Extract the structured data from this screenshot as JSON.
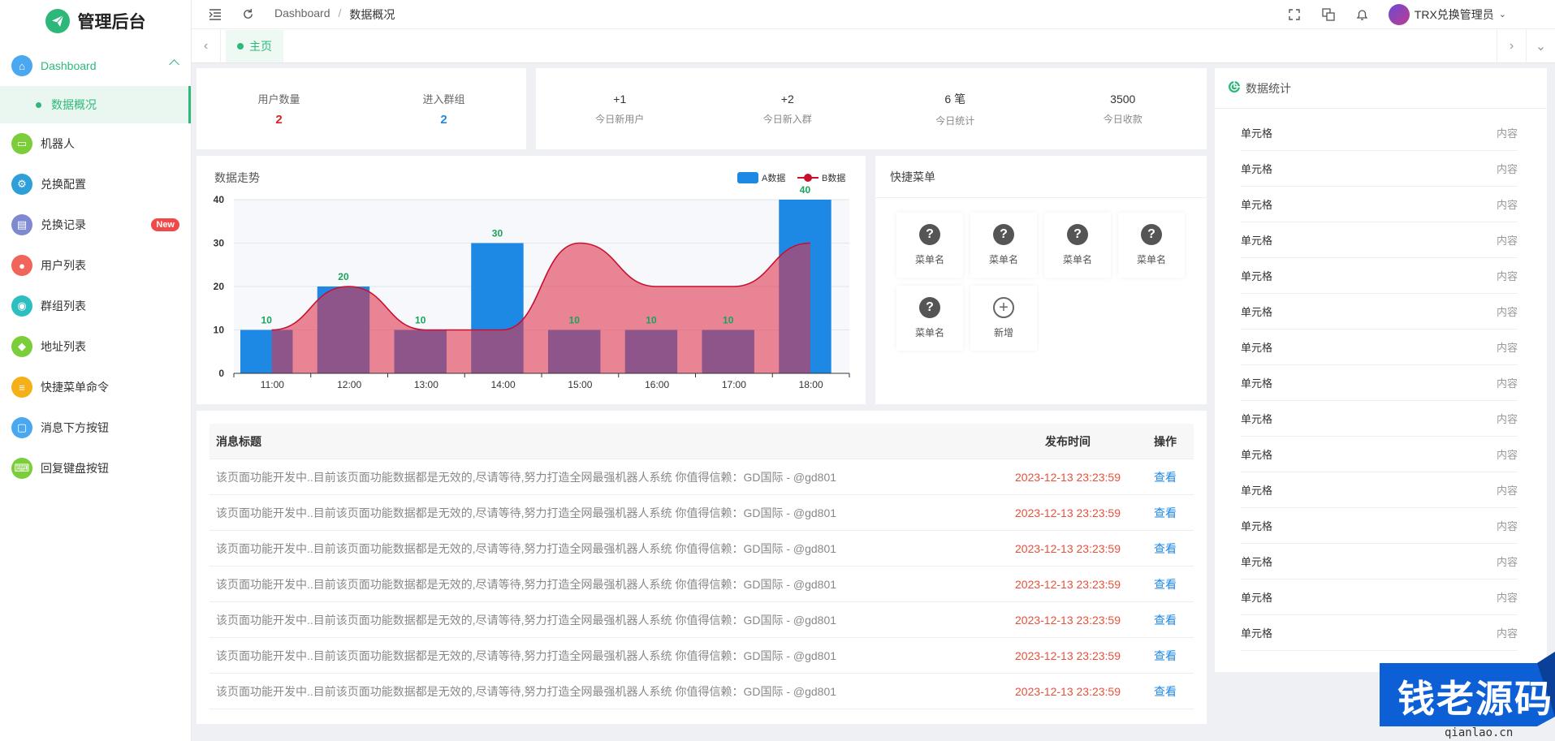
{
  "app": {
    "title": "管理后台"
  },
  "sidebar": {
    "items": [
      {
        "label": "Dashboard",
        "color": "#4aa8f0",
        "icon": "home-icon"
      },
      {
        "label": "机器人",
        "color": "#7ccd3a",
        "icon": "monitor-icon"
      },
      {
        "label": "兑换配置",
        "color": "#2e9fd8",
        "icon": "gear-icon"
      },
      {
        "label": "兑换记录",
        "color": "#7d8ad0",
        "icon": "document-icon",
        "badge": "New"
      },
      {
        "label": "用户列表",
        "color": "#f0645a",
        "icon": "user-icon"
      },
      {
        "label": "群组列表",
        "color": "#2dbfbf",
        "icon": "group-icon"
      },
      {
        "label": "地址列表",
        "color": "#7ccd3a",
        "icon": "cube-icon"
      },
      {
        "label": "快捷菜单命令",
        "color": "#f5b019",
        "icon": "sliders-icon"
      },
      {
        "label": "消息下方按钮",
        "color": "#4aa8f0",
        "icon": "card-icon"
      },
      {
        "label": "回复键盘按钮",
        "color": "#7ccd3a",
        "icon": "keyboard-icon"
      }
    ],
    "sub_item": "数据概况"
  },
  "topbar": {
    "breadcrumb": [
      "Dashboard",
      "/",
      "数据概况"
    ],
    "user": "TRX兑换管理员"
  },
  "tabs": [
    {
      "label": "主页"
    }
  ],
  "stats_users": {
    "user_count_label": "用户数量",
    "user_count": "2",
    "group_label": "进入群组",
    "group_count": "2"
  },
  "stats_today": [
    {
      "value": "+1",
      "label": "今日新用户"
    },
    {
      "value": "+2",
      "label": "今日新入群"
    },
    {
      "value": "6 笔",
      "label": "今日统计"
    },
    {
      "value": "3500",
      "label": "今日收款"
    }
  ],
  "chart_title": "数据走势",
  "chart_data": {
    "type": "bar",
    "categories": [
      "11:00",
      "12:00",
      "13:00",
      "14:00",
      "15:00",
      "16:00",
      "17:00",
      "18:00"
    ],
    "series": [
      {
        "name": "A数据",
        "type": "bar",
        "color": "#1e88e5",
        "values": [
          10,
          20,
          10,
          30,
          10,
          10,
          10,
          40
        ]
      },
      {
        "name": "B数据",
        "type": "area",
        "color": "#e0304a",
        "values": [
          10,
          20,
          10,
          10,
          30,
          20,
          20,
          30
        ]
      }
    ],
    "ylim": [
      0,
      40
    ],
    "yticks": [
      0,
      10,
      20,
      30,
      40
    ],
    "bar_labels": [
      "10",
      "20",
      "10",
      "30",
      "10",
      "10",
      "10",
      "40"
    ],
    "legend": "top-right",
    "grid": true
  },
  "quick_menu": {
    "title": "快捷菜单",
    "items": [
      "菜单名",
      "菜单名",
      "菜单名",
      "菜单名",
      "菜单名"
    ],
    "add_label": "新增"
  },
  "messages": {
    "headers": {
      "title": "消息标题",
      "time": "发布时间",
      "op": "操作"
    },
    "rows": [
      {
        "title": "该页面功能开发中..目前该页面功能数据都是无效的,尽请等待,努力打造全网最强机器人系统 你值得信赖：GD国际 - @gd801",
        "time": "2023-12-13 23:23:59",
        "op": "查看"
      },
      {
        "title": "该页面功能开发中..目前该页面功能数据都是无效的,尽请等待,努力打造全网最强机器人系统 你值得信赖：GD国际 - @gd801",
        "time": "2023-12-13 23:23:59",
        "op": "查看"
      },
      {
        "title": "该页面功能开发中..目前该页面功能数据都是无效的,尽请等待,努力打造全网最强机器人系统 你值得信赖：GD国际 - @gd801",
        "time": "2023-12-13 23:23:59",
        "op": "查看"
      },
      {
        "title": "该页面功能开发中..目前该页面功能数据都是无效的,尽请等待,努力打造全网最强机器人系统 你值得信赖：GD国际 - @gd801",
        "time": "2023-12-13 23:23:59",
        "op": "查看"
      },
      {
        "title": "该页面功能开发中..目前该页面功能数据都是无效的,尽请等待,努力打造全网最强机器人系统 你值得信赖：GD国际 - @gd801",
        "time": "2023-12-13 23:23:59",
        "op": "查看"
      },
      {
        "title": "该页面功能开发中..目前该页面功能数据都是无效的,尽请等待,努力打造全网最强机器人系统 你值得信赖：GD国际 - @gd801",
        "time": "2023-12-13 23:23:59",
        "op": "查看"
      },
      {
        "title": "该页面功能开发中..目前该页面功能数据都是无效的,尽请等待,努力打造全网最强机器人系统 你值得信赖：GD国际 - @gd801",
        "time": "2023-12-13 23:23:59",
        "op": "查看"
      }
    ]
  },
  "right_stats": {
    "title": "数据统计",
    "rows": [
      {
        "k": "单元格",
        "v": "内容"
      },
      {
        "k": "单元格",
        "v": "内容"
      },
      {
        "k": "单元格",
        "v": "内容"
      },
      {
        "k": "单元格",
        "v": "内容"
      },
      {
        "k": "单元格",
        "v": "内容"
      },
      {
        "k": "单元格",
        "v": "内容"
      },
      {
        "k": "单元格",
        "v": "内容"
      },
      {
        "k": "单元格",
        "v": "内容"
      },
      {
        "k": "单元格",
        "v": "内容"
      },
      {
        "k": "单元格",
        "v": "内容"
      },
      {
        "k": "单元格",
        "v": "内容"
      },
      {
        "k": "单元格",
        "v": "内容"
      },
      {
        "k": "单元格",
        "v": "内容"
      },
      {
        "k": "单元格",
        "v": "内容"
      },
      {
        "k": "单元格",
        "v": "内容"
      }
    ]
  },
  "watermark": {
    "text": "钱老源码",
    "url": "qianlao.cn"
  }
}
